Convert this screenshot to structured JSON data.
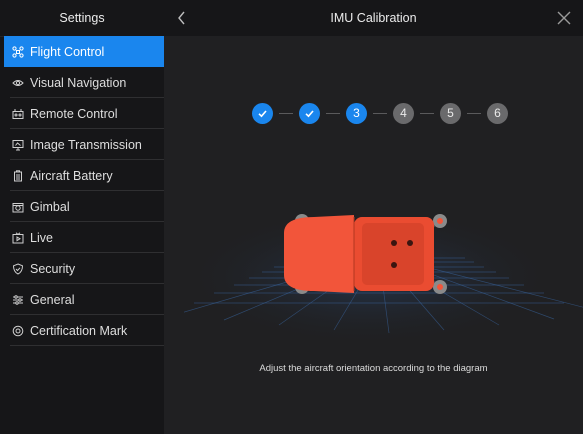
{
  "sidebar": {
    "title": "Settings",
    "items": [
      {
        "label": "Flight Control",
        "icon": "drone-icon",
        "active": true
      },
      {
        "label": "Visual Navigation",
        "icon": "eye-icon",
        "active": false
      },
      {
        "label": "Remote Control",
        "icon": "remote-controller-icon",
        "active": false
      },
      {
        "label": "Image Transmission",
        "icon": "monitor-icon",
        "active": false
      },
      {
        "label": "Aircraft Battery",
        "icon": "battery-icon",
        "active": false
      },
      {
        "label": "Gimbal",
        "icon": "camera-icon",
        "active": false
      },
      {
        "label": "Live",
        "icon": "live-stream-icon",
        "active": false
      },
      {
        "label": "Security",
        "icon": "shield-icon",
        "active": false
      },
      {
        "label": "General",
        "icon": "sliders-icon",
        "active": false
      },
      {
        "label": "Certification Mark",
        "icon": "certificate-icon",
        "active": false
      }
    ]
  },
  "header": {
    "title": "IMU Calibration",
    "back_icon": "chevron-left-icon",
    "close_icon": "close-icon"
  },
  "stepper": {
    "current_step": 3,
    "total_steps": 6,
    "steps": [
      {
        "label": "1",
        "state": "done"
      },
      {
        "label": "2",
        "state": "done"
      },
      {
        "label": "3",
        "state": "current"
      },
      {
        "label": "4",
        "state": "pending"
      },
      {
        "label": "5",
        "state": "pending"
      },
      {
        "label": "6",
        "state": "pending"
      }
    ]
  },
  "instruction": "Adjust the aircraft orientation according to the diagram",
  "colors": {
    "accent": "#1a86ee",
    "sidebar_bg": "#161618",
    "main_bg": "#202022",
    "aircraft": "#f2553a",
    "pending_step": "#6a6a6c"
  }
}
